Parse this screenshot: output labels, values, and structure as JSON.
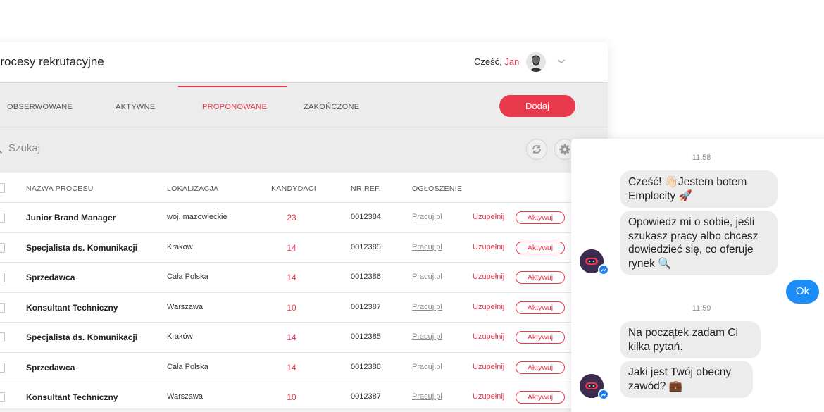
{
  "header": {
    "title": "Procesy rekrutacyjne",
    "greeting_prefix": "Cześć,",
    "user_name": "Jan"
  },
  "tabs": [
    {
      "label": "OBSERWOWANE",
      "active": false
    },
    {
      "label": "AKTYWNE",
      "active": false
    },
    {
      "label": "PROPONOWANE",
      "active": true
    },
    {
      "label": "ZAKOŃCZONE",
      "active": false
    }
  ],
  "add_button": "Dodaj",
  "search": {
    "placeholder": "Szukaj"
  },
  "table": {
    "headers": [
      "NAZWA PROCESU",
      "LOKALIZACJA",
      "KANDYDACI",
      "NR REF.",
      "OGŁOSZENIE"
    ],
    "rows": [
      {
        "name": "Junior Brand Manager",
        "location": "woj. mazowieckie",
        "candidates": "23",
        "ref": "0012384",
        "ad": "Pracuj.pl",
        "fill": "Uzupełnij",
        "activate": "Aktywuj"
      },
      {
        "name": "Specjalista ds. Komunikacji",
        "location": "Kraków",
        "candidates": "14",
        "ref": "0012385",
        "ad": "Pracuj.pl",
        "fill": "Uzupełnij",
        "activate": "Aktywuj"
      },
      {
        "name": "Sprzedawca",
        "location": "Cała Polska",
        "candidates": "14",
        "ref": "0012386",
        "ad": "Pracuj.pl",
        "fill": "Uzupełnij",
        "activate": "Aktywuj"
      },
      {
        "name": "Konsultant Techniczny",
        "location": "Warszawa",
        "candidates": "10",
        "ref": "0012387",
        "ad": "Pracuj.pl",
        "fill": "Uzupełnij",
        "activate": "Aktywuj"
      },
      {
        "name": "Specjalista ds. Komunikacji",
        "location": "Kraków",
        "candidates": "14",
        "ref": "0012385",
        "ad": "Pracuj.pl",
        "fill": "Uzupełnij",
        "activate": "Aktywuj"
      },
      {
        "name": "Sprzedawca",
        "location": "Cała Polska",
        "candidates": "14",
        "ref": "0012386",
        "ad": "Pracuj.pl",
        "fill": "Uzupełnij",
        "activate": "Aktywuj"
      },
      {
        "name": "Konsultant Techniczny",
        "location": "Warszawa",
        "candidates": "10",
        "ref": "0012387",
        "ad": "Pracuj.pl",
        "fill": "Uzupełnij",
        "activate": "Aktywuj"
      }
    ]
  },
  "chat": {
    "time1": "11:58",
    "msg1": "Cześć! 👋🏻Jestem botem Emplocity 🚀",
    "msg2": "Opowiedz mi o sobie, jeśli szukasz pracy albo chcesz dowiedzieć się, co oferuje rynek 🔍",
    "user_reply": "Ok",
    "time2": "11:59",
    "msg3": "Na początek zadam Ci kilka pytań.",
    "msg4": "Jaki jest Twój obecny zawód? 💼"
  },
  "colors": {
    "accent": "#e8394d",
    "messenger_blue": "#1d8ef8"
  },
  "icons": [
    "user-avatar",
    "chevron-down-icon",
    "search-icon",
    "refresh-icon",
    "gear-icon",
    "bot-avatar",
    "messenger-icon"
  ]
}
